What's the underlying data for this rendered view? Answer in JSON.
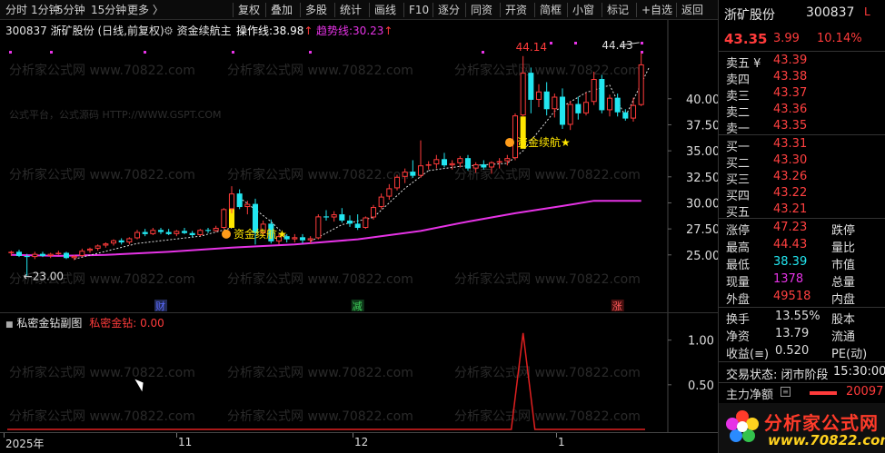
{
  "toolbar": {
    "items": [
      "分时",
      "1分钟",
      "5分钟",
      "15分钟",
      "更多 〉",
      "复权",
      "叠加",
      "多股",
      "统计",
      "画线",
      "F10",
      "逐分",
      "同资",
      "开资",
      "简框",
      "小窗",
      "标记",
      "+自选",
      "返回"
    ]
  },
  "chart_header": {
    "code": "300837",
    "name": "浙矿股份",
    "period": "(日线,前复权)",
    "indicator": "资金续航主",
    "line1_label": "操作线:",
    "line1_value": "38.98",
    "line1_arrow": "↑",
    "line2_label": "趋势线:",
    "line2_value": "30.23",
    "line2_arrow": "↑"
  },
  "watermark": {
    "text": "分析家公式网 www.70822.com",
    "faint": "公式平台，公式源码 HTTP://WWW.GSPT.COM"
  },
  "annotations": {
    "low_label": "←23.00",
    "peak_label": "44.14",
    "high_label": "44.43",
    "signal_label": "资金续航★",
    "marker_cai": "财",
    "marker_jian": "减",
    "marker_zhang": "涨"
  },
  "sub_header": {
    "title": "私密金钻副图",
    "label": "私密金钻:",
    "value": "0.00"
  },
  "date_axis": [
    "2025年",
    "11",
    "12",
    "1"
  ],
  "colors": {
    "up": "#ff3b3b",
    "down": "#22e6f0",
    "signal": "#ffe600",
    "trend": "#e633e6",
    "dash": "#e0e0e0"
  },
  "chart_data": {
    "type": "candlestick",
    "ylim": [
      23.5,
      46
    ],
    "yticks": [
      25.0,
      27.5,
      30.0,
      32.5,
      35.0,
      37.5,
      40.0
    ],
    "sub_ylim": [
      0,
      1.2
    ],
    "sub_yticks": [
      1.0,
      0.5
    ],
    "candles": [
      [
        25.2,
        25.4,
        24.9,
        25.3
      ],
      [
        25.3,
        25.5,
        24.8,
        24.9
      ],
      [
        24.9,
        25.1,
        23.0,
        24.8
      ],
      [
        24.8,
        25.3,
        24.6,
        25.1
      ],
      [
        25.1,
        25.3,
        24.8,
        24.9
      ],
      [
        24.9,
        25.2,
        24.7,
        25.1
      ],
      [
        25.1,
        25.4,
        25.0,
        25.2
      ],
      [
        25.2,
        25.3,
        24.6,
        24.7
      ],
      [
        24.7,
        25.0,
        24.5,
        24.9
      ],
      [
        24.9,
        25.6,
        24.8,
        25.4
      ],
      [
        25.4,
        25.7,
        25.2,
        25.6
      ],
      [
        25.6,
        26.0,
        25.4,
        25.9
      ],
      [
        25.9,
        26.2,
        25.7,
        26.1
      ],
      [
        26.1,
        26.5,
        25.9,
        26.4
      ],
      [
        26.4,
        26.6,
        26.0,
        26.2
      ],
      [
        26.2,
        26.7,
        26.0,
        26.6
      ],
      [
        26.6,
        27.4,
        26.5,
        27.2
      ],
      [
        27.2,
        27.5,
        26.8,
        27.0
      ],
      [
        27.0,
        27.6,
        26.9,
        27.4
      ],
      [
        27.4,
        27.6,
        27.0,
        27.2
      ],
      [
        27.2,
        27.5,
        26.9,
        27.0
      ],
      [
        27.0,
        27.4,
        26.8,
        27.3
      ],
      [
        27.3,
        27.6,
        27.0,
        27.1
      ],
      [
        27.1,
        27.3,
        26.7,
        26.9
      ],
      [
        26.9,
        27.5,
        26.8,
        27.4
      ],
      [
        27.4,
        27.6,
        27.1,
        27.3
      ],
      [
        27.3,
        27.8,
        27.2,
        27.6
      ],
      [
        27.6,
        29.5,
        27.5,
        29.4
      ],
      [
        29.4,
        31.6,
        29.0,
        30.9
      ],
      [
        30.9,
        31.3,
        29.4,
        29.6
      ],
      [
        29.6,
        30.2,
        28.9,
        29.9
      ],
      [
        29.9,
        30.4,
        26.0,
        27.1
      ],
      [
        27.1,
        28.3,
        26.8,
        28.0
      ],
      [
        28.0,
        28.4,
        26.1,
        26.3
      ],
      [
        26.3,
        27.0,
        26.0,
        26.8
      ],
      [
        26.8,
        27.0,
        26.2,
        26.5
      ],
      [
        26.5,
        27.0,
        26.2,
        26.7
      ],
      [
        26.7,
        27.0,
        26.1,
        26.4
      ],
      [
        26.4,
        26.8,
        26.1,
        26.6
      ],
      [
        26.6,
        28.9,
        26.5,
        28.7
      ],
      [
        28.7,
        29.3,
        28.3,
        28.6
      ],
      [
        28.6,
        29.2,
        28.2,
        28.9
      ],
      [
        28.9,
        29.5,
        28.1,
        28.3
      ],
      [
        28.3,
        28.8,
        27.7,
        28.0
      ],
      [
        28.0,
        28.9,
        27.4,
        27.6
      ],
      [
        27.6,
        28.7,
        27.5,
        28.6
      ],
      [
        28.6,
        29.8,
        28.4,
        29.6
      ],
      [
        29.6,
        30.9,
        29.4,
        30.6
      ],
      [
        30.6,
        31.8,
        30.3,
        31.4
      ],
      [
        31.4,
        32.7,
        31.2,
        32.5
      ],
      [
        32.5,
        33.3,
        31.9,
        33.0
      ],
      [
        33.0,
        34.1,
        32.4,
        32.6
      ],
      [
        32.6,
        36.0,
        32.4,
        33.6
      ],
      [
        33.6,
        34.0,
        33.2,
        33.7
      ],
      [
        33.7,
        34.6,
        33.3,
        34.2
      ],
      [
        34.2,
        34.8,
        33.4,
        33.6
      ],
      [
        33.6,
        34.1,
        33.2,
        33.8
      ],
      [
        33.8,
        34.5,
        33.4,
        34.3
      ],
      [
        34.3,
        34.6,
        33.1,
        33.3
      ],
      [
        33.3,
        33.9,
        32.9,
        33.7
      ],
      [
        33.7,
        34.1,
        33.2,
        33.4
      ],
      [
        33.4,
        34.0,
        32.8,
        33.9
      ],
      [
        33.9,
        34.3,
        33.3,
        34.0
      ],
      [
        34.0,
        34.6,
        33.6,
        34.3
      ],
      [
        34.3,
        38.6,
        34.1,
        38.4
      ],
      [
        38.4,
        44.1,
        38.3,
        42.5
      ],
      [
        42.5,
        43.0,
        38.6,
        39.9
      ],
      [
        39.9,
        41.4,
        39.2,
        40.7
      ],
      [
        40.7,
        41.6,
        38.4,
        39.0
      ],
      [
        39.0,
        40.5,
        38.2,
        40.2
      ],
      [
        40.2,
        41.0,
        37.1,
        37.5
      ],
      [
        37.5,
        39.8,
        37.0,
        39.5
      ],
      [
        39.5,
        40.2,
        38.0,
        38.6
      ],
      [
        38.6,
        40.6,
        38.4,
        39.7
      ],
      [
        39.7,
        42.6,
        39.4,
        41.9
      ],
      [
        41.9,
        42.3,
        38.6,
        38.9
      ],
      [
        38.9,
        40.4,
        38.3,
        40.1
      ],
      [
        40.1,
        40.5,
        38.3,
        38.7
      ],
      [
        38.7,
        39.0,
        37.9,
        38.1
      ],
      [
        38.1,
        40.1,
        37.8,
        39.4
      ],
      [
        39.4,
        44.4,
        39.3,
        43.3
      ]
    ],
    "trend_line": [
      [
        0,
        25.0
      ],
      [
        6,
        24.9
      ],
      [
        12,
        25.0
      ],
      [
        20,
        25.3
      ],
      [
        28,
        25.7
      ],
      [
        36,
        26.0
      ],
      [
        44,
        26.5
      ],
      [
        52,
        27.3
      ],
      [
        58,
        28.2
      ],
      [
        64,
        29.0
      ],
      [
        70,
        29.7
      ],
      [
        74,
        30.2
      ],
      [
        80,
        30.2
      ]
    ],
    "dashed_segments": [
      [
        [
          8,
          24.6
        ],
        [
          16,
          26.1
        ],
        [
          24,
          26.8
        ],
        [
          28,
          27.6
        ]
      ],
      [
        [
          29,
          30.5
        ],
        [
          33,
          28.2
        ],
        [
          35,
          26.7
        ]
      ],
      [
        [
          38,
          26.3
        ],
        [
          42,
          27.9
        ],
        [
          46,
          28.6
        ],
        [
          50,
          31.4
        ],
        [
          53,
          33.1
        ]
      ],
      [
        [
          53,
          33.1
        ],
        [
          57,
          33.5
        ],
        [
          63,
          33.8
        ],
        [
          65,
          35.0
        ],
        [
          69,
          38.8
        ],
        [
          73,
          40.6
        ],
        [
          76,
          41.3
        ],
        [
          78,
          38.3
        ],
        [
          81,
          43.0
        ]
      ]
    ],
    "yellow_bars": [
      [
        28,
        30.8,
        27.6
      ],
      [
        65,
        38.3,
        35.2
      ]
    ],
    "sub_series": [
      {
        "name": "私密金钻",
        "spike_index": 65,
        "spike_value": 1.08
      }
    ]
  },
  "panel": {
    "name": "浙矿股份",
    "code": "300837",
    "flag": "L",
    "price": "43.35",
    "change": "3.99",
    "change_pct": "10.14%",
    "asks": [
      {
        "label": "卖五 ¥",
        "price": "43.39"
      },
      {
        "label": "卖四",
        "price": "43.38"
      },
      {
        "label": "卖三",
        "price": "43.37"
      },
      {
        "label": "卖二",
        "price": "43.36"
      },
      {
        "label": "卖一",
        "price": "43.35"
      }
    ],
    "bids": [
      {
        "label": "买一",
        "price": "43.31"
      },
      {
        "label": "买二",
        "price": "43.30"
      },
      {
        "label": "买三",
        "price": "43.26"
      },
      {
        "label": "买四",
        "price": "43.22"
      },
      {
        "label": "买五",
        "price": "43.21"
      }
    ],
    "stats": [
      {
        "l": "涨停",
        "v": "47.23",
        "r": "跌停",
        "c": "#ff4040"
      },
      {
        "l": "最高",
        "v": "44.43",
        "r": "量比",
        "c": "#ff4040"
      },
      {
        "l": "最低",
        "v": "38.39",
        "r": "市值",
        "c": "#22e6f0"
      },
      {
        "l": "现量",
        "v": "1378",
        "r": "总量",
        "c": "#e633e6"
      },
      {
        "l": "外盘",
        "v": "49518",
        "r": "内盘",
        "c": "#ff4040"
      }
    ],
    "stats2": [
      {
        "l": "换手",
        "v": "13.55%",
        "r": "股本"
      },
      {
        "l": "净资",
        "v": "13.79",
        "r": "流通"
      },
      {
        "l": "收益(≡)",
        "v": "0.520",
        "r": "PE(动)"
      }
    ],
    "trade_status": "交易状态: 闭市阶段",
    "trade_time": "15:30:00",
    "main_flow_label": "主力净额",
    "main_flow_value": "20097",
    "logo_title": "分析家公式网",
    "logo_url": "www.70822.com"
  }
}
